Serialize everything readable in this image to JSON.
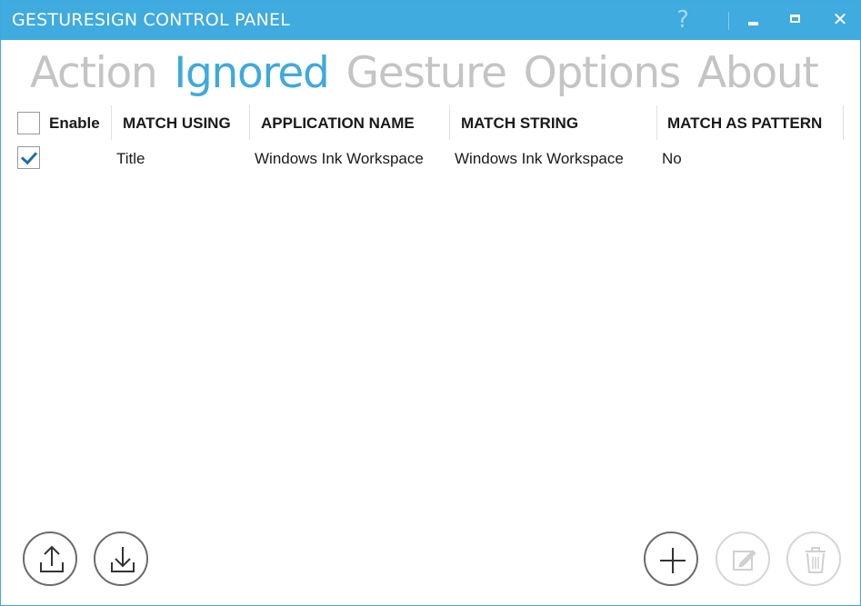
{
  "window": {
    "title": "GESTURESIGN CONTROL PANEL",
    "help_glyph": "?",
    "close_glyph": "✕"
  },
  "tabs": [
    {
      "label": "Action",
      "active": false
    },
    {
      "label": "Ignored",
      "active": true
    },
    {
      "label": "Gesture",
      "active": false
    },
    {
      "label": "Options",
      "active": false
    },
    {
      "label": "About",
      "active": false
    }
  ],
  "table": {
    "columns": {
      "enable": "Enable",
      "match_using": "MATCH USING",
      "application_name": "APPLICATION NAME",
      "match_string": "MATCH STRING",
      "match_as_pattern": "MATCH AS PATTERN"
    },
    "select_all_checked": false,
    "rows": [
      {
        "enabled": true,
        "match_using": "Title",
        "application_name": "Windows Ink Workspace",
        "match_string": "Windows Ink Workspace",
        "match_as_pattern": "No"
      }
    ]
  },
  "actions": {
    "export": {
      "icon": "export-icon",
      "enabled": true
    },
    "import": {
      "icon": "import-icon",
      "enabled": true
    },
    "add": {
      "icon": "plus-icon",
      "enabled": true
    },
    "edit": {
      "icon": "edit-icon",
      "enabled": false
    },
    "delete": {
      "icon": "trash-icon",
      "enabled": false
    }
  },
  "colors": {
    "accent": "#3fabde",
    "tab_inactive": "#c4c4c4",
    "check": "#1f6fa8"
  }
}
